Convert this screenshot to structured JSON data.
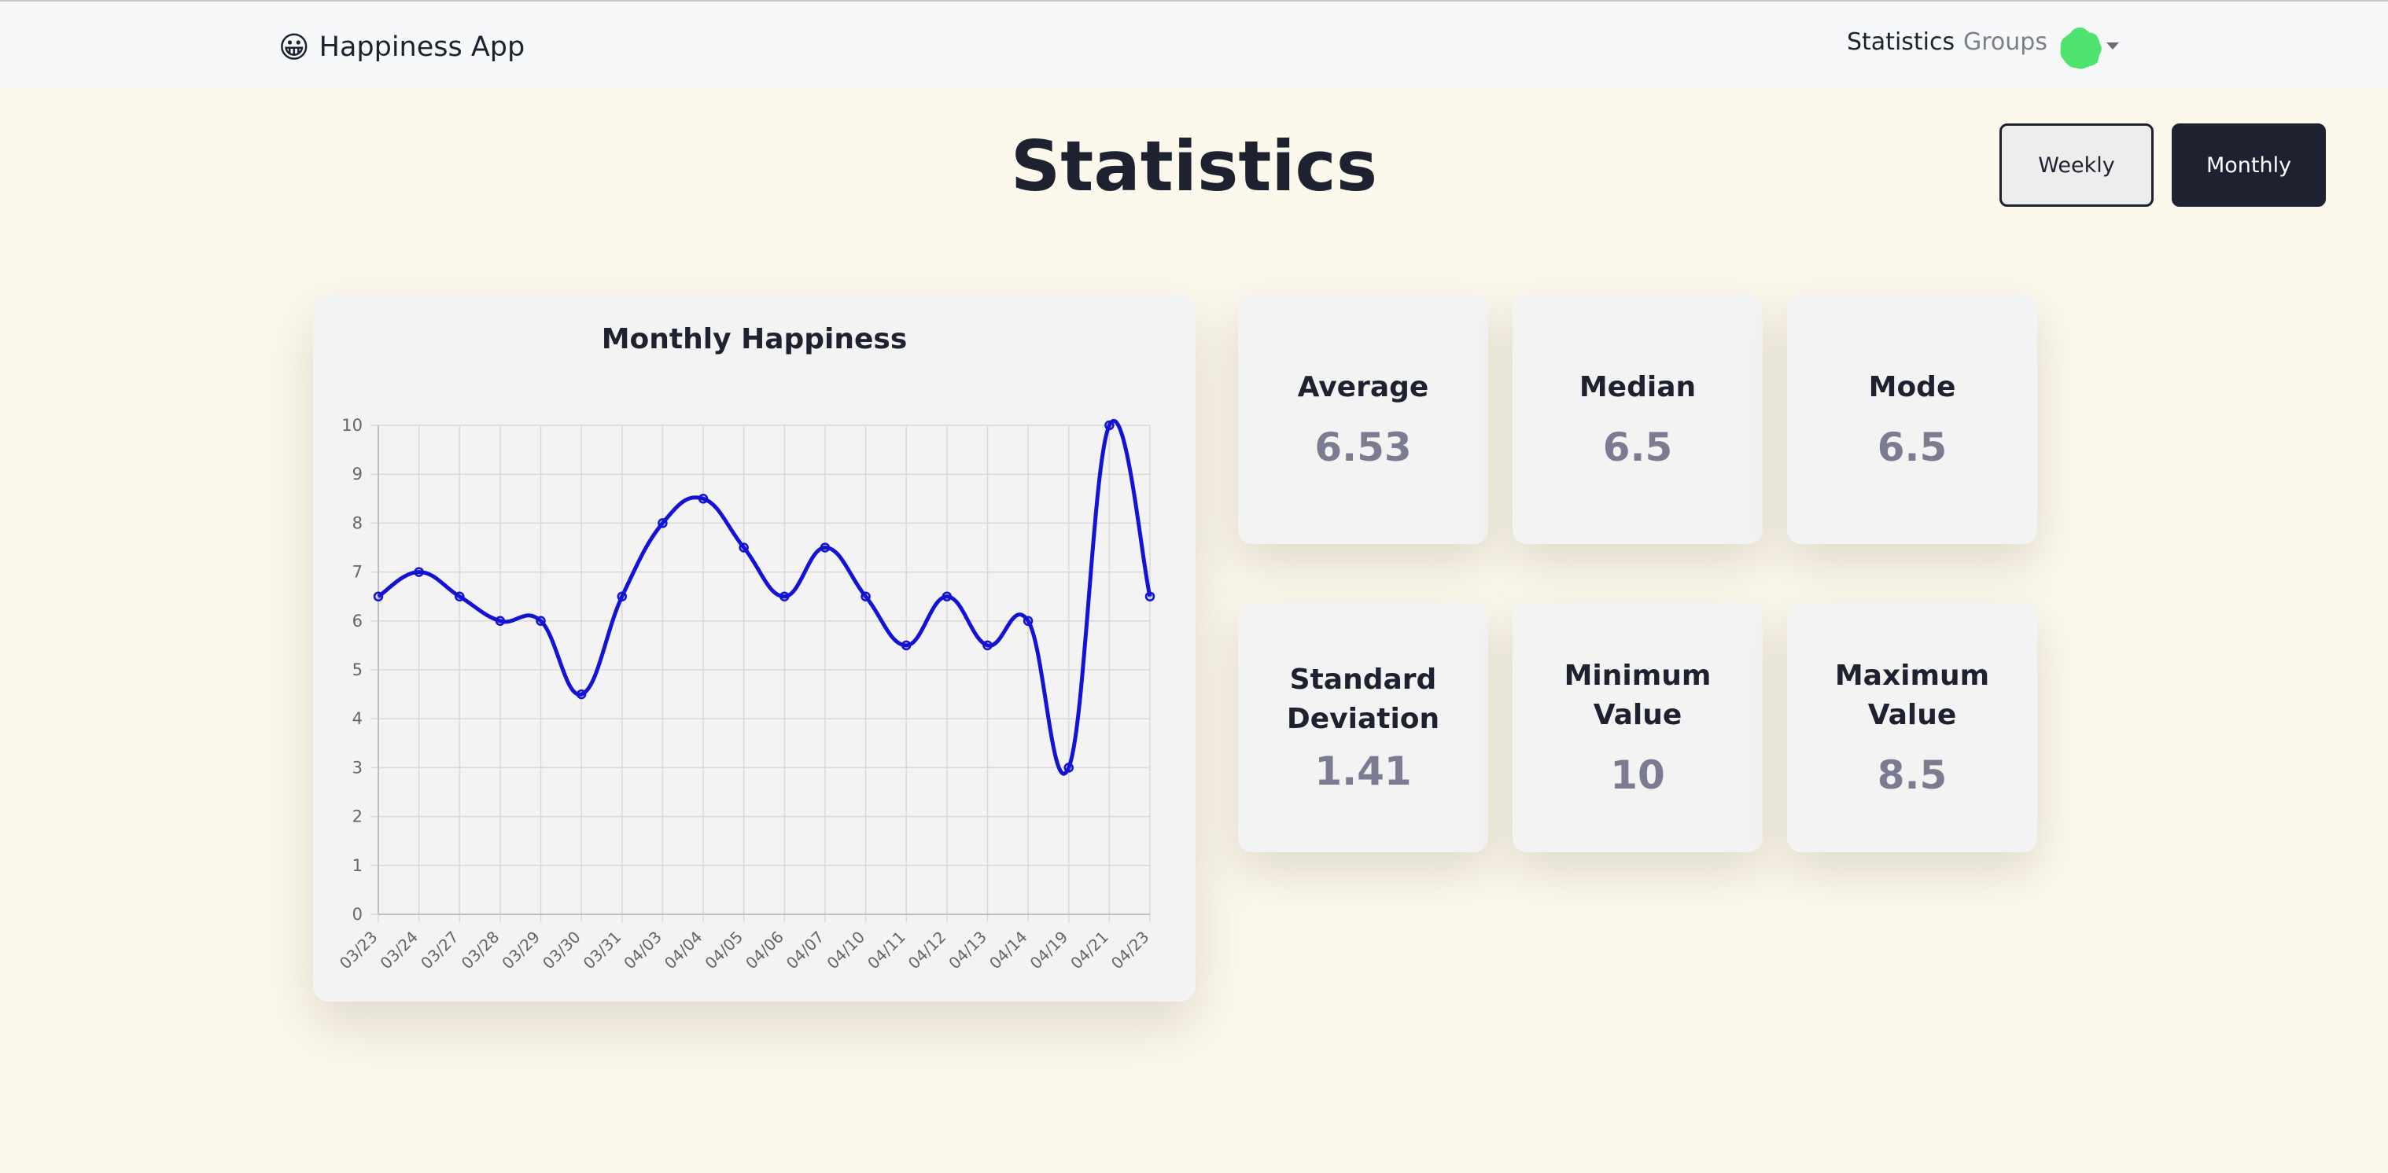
{
  "app": {
    "brand_emoji": "😀",
    "brand_name": "Happiness App"
  },
  "nav": {
    "links": [
      "Statistics",
      "Groups"
    ],
    "avatar_icon": "green-blob-avatar",
    "avatar_color": "#4ee36f"
  },
  "page": {
    "title": "Statistics",
    "toggle": {
      "weekly_label": "Weekly",
      "monthly_label": "Monthly",
      "selected": "Monthly"
    }
  },
  "stats": [
    {
      "label": "Average",
      "value": "6.53"
    },
    {
      "label": "Median",
      "value": "6.5"
    },
    {
      "label": "Mode",
      "value": "6.5"
    },
    {
      "label": "Standard Deviation",
      "value": "1.41"
    },
    {
      "label": "Minimum Value",
      "value": "10"
    },
    {
      "label": "Maximum Value",
      "value": "8.5"
    }
  ],
  "chart_data": {
    "type": "line",
    "title": "Monthly Happiness",
    "xlabel": "",
    "ylabel": "",
    "categories": [
      "03/23",
      "03/24",
      "03/27",
      "03/28",
      "03/29",
      "03/30",
      "03/31",
      "04/03",
      "04/04",
      "04/05",
      "04/06",
      "04/07",
      "04/10",
      "04/11",
      "04/12",
      "04/13",
      "04/14",
      "04/19",
      "04/21",
      "04/23"
    ],
    "values": [
      6.5,
      7,
      6.5,
      6,
      6,
      4.5,
      6.5,
      8,
      8.5,
      7.5,
      6.5,
      7.5,
      6.5,
      5.5,
      6.5,
      5.5,
      6,
      3,
      10,
      6.5
    ],
    "ylim": [
      0,
      10
    ],
    "yticks": [
      0,
      1,
      2,
      3,
      4,
      5,
      6,
      7,
      8,
      9,
      10
    ],
    "grid": true,
    "line_color": "#1313d6"
  }
}
